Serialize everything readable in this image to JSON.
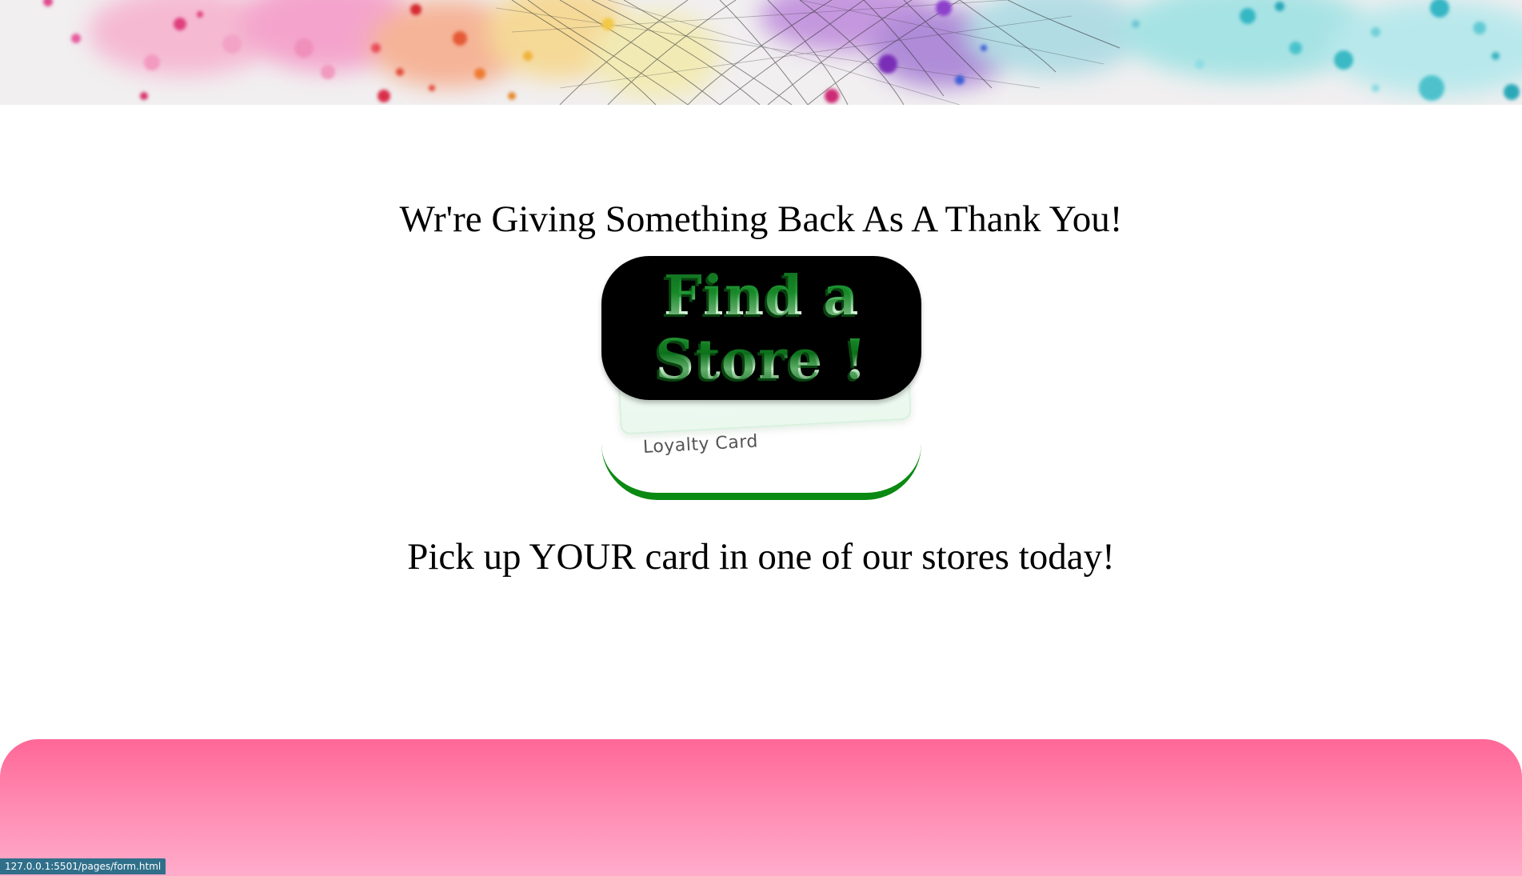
{
  "banner": {
    "image_name": "watercolor-splash-banner"
  },
  "headline": {
    "text": "Wr're Giving Something Back As A Thank You!"
  },
  "store_button": {
    "label": "Find a Store !"
  },
  "loyalty_card": {
    "label": "Loyalty Card"
  },
  "subline": {
    "text": "Pick up YOUR card in one of our stores today!"
  },
  "status_bar": {
    "url": "127.0.0.1:5501/pages/form.html"
  },
  "colors": {
    "button_bg": "#000000",
    "button_text": "#1f9a34",
    "card_accent": "#0a8a12",
    "footer_top": "#ff6797",
    "footer_bottom": "#ffaccb"
  }
}
